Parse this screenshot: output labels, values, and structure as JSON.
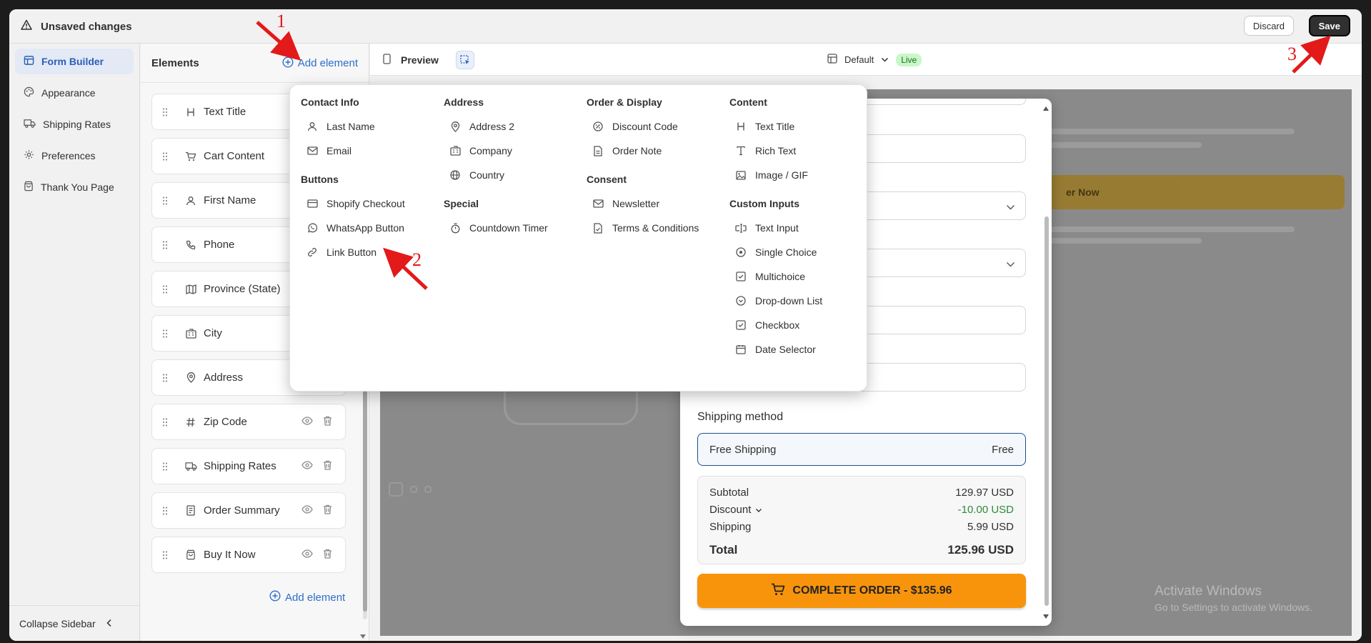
{
  "topbar": {
    "title": "Unsaved changes",
    "discard_label": "Discard",
    "save_label": "Save"
  },
  "sidebar": {
    "items": [
      {
        "label": "Form Builder",
        "icon": "layout-icon",
        "active": true
      },
      {
        "label": "Appearance",
        "icon": "palette-icon",
        "active": false
      },
      {
        "label": "Shipping Rates",
        "icon": "truck-icon",
        "active": false
      },
      {
        "label": "Preferences",
        "icon": "gear-icon",
        "active": false
      },
      {
        "label": "Thank You Page",
        "icon": "bag-icon",
        "active": false
      }
    ],
    "collapse_label": "Collapse Sidebar"
  },
  "elements_panel": {
    "title": "Elements",
    "add_label": "Add element",
    "bottom_add_label": "Add element",
    "items": [
      {
        "label": "Text Title",
        "icon": "heading-icon"
      },
      {
        "label": "Cart Content",
        "icon": "cart-icon"
      },
      {
        "label": "First Name",
        "icon": "user-icon"
      },
      {
        "label": "Phone",
        "icon": "phone-icon"
      },
      {
        "label": "Province (State)",
        "icon": "map-icon"
      },
      {
        "label": "City",
        "icon": "building-icon"
      },
      {
        "label": "Address",
        "icon": "pin-icon"
      },
      {
        "label": "Zip Code",
        "icon": "hash-icon"
      },
      {
        "label": "Shipping Rates",
        "icon": "truck-icon"
      },
      {
        "label": "Order Summary",
        "icon": "receipt-icon"
      },
      {
        "label": "Buy It Now",
        "icon": "bag-icon"
      }
    ]
  },
  "preview": {
    "label": "Preview",
    "template": "Default",
    "status": "Live",
    "ghost_button": "er Now",
    "shipping_method_label": "Shipping method",
    "shipping_option": {
      "name": "Free Shipping",
      "price": "Free"
    },
    "summary": {
      "subtotal_label": "Subtotal",
      "subtotal": "129.97 USD",
      "discount_label": "Discount",
      "discount": "-10.00 USD",
      "shipping_label": "Shipping",
      "shipping": "5.99 USD",
      "total_label": "Total",
      "total": "125.96 USD"
    },
    "cta_label": "COMPLETE ORDER - $135.96",
    "watermark_title": "Activate Windows",
    "watermark_sub": "Go to Settings to activate Windows."
  },
  "dropdown": {
    "columns": [
      {
        "groups": [
          {
            "title": "Contact Info",
            "items": [
              {
                "label": "Last Name",
                "icon": "user-icon"
              },
              {
                "label": "Email",
                "icon": "mail-icon"
              }
            ]
          },
          {
            "title": "Buttons",
            "items": [
              {
                "label": "Shopify Checkout",
                "icon": "card-icon"
              },
              {
                "label": "WhatsApp Button",
                "icon": "whatsapp-icon"
              },
              {
                "label": "Link Button",
                "icon": "link-icon"
              }
            ]
          }
        ]
      },
      {
        "groups": [
          {
            "title": "Address",
            "items": [
              {
                "label": "Address 2",
                "icon": "pin-icon"
              },
              {
                "label": "Company",
                "icon": "building-icon"
              },
              {
                "label": "Country",
                "icon": "globe-icon"
              }
            ]
          },
          {
            "title": "Special",
            "items": [
              {
                "label": "Countdown Timer",
                "icon": "timer-icon"
              }
            ]
          }
        ]
      },
      {
        "groups": [
          {
            "title": "Order & Display",
            "items": [
              {
                "label": "Discount Code",
                "icon": "discount-icon"
              },
              {
                "label": "Order Note",
                "icon": "note-icon"
              }
            ]
          },
          {
            "title": "Consent",
            "items": [
              {
                "label": "Newsletter",
                "icon": "mail-icon"
              },
              {
                "label": "Terms & Conditions",
                "icon": "document-icon"
              }
            ]
          }
        ]
      },
      {
        "groups": [
          {
            "title": "Content",
            "items": [
              {
                "label": "Text Title",
                "icon": "heading-icon"
              },
              {
                "label": "Rich Text",
                "icon": "type-icon"
              },
              {
                "label": "Image / GIF",
                "icon": "image-icon"
              }
            ]
          },
          {
            "title": "Custom Inputs",
            "items": [
              {
                "label": "Text Input",
                "icon": "text-input-icon"
              },
              {
                "label": "Single Choice",
                "icon": "radio-icon"
              },
              {
                "label": "Multichoice",
                "icon": "checkbox-icon"
              },
              {
                "label": "Drop-down List",
                "icon": "chevron-circle-icon"
              },
              {
                "label": "Checkbox",
                "icon": "checkbox-icon"
              },
              {
                "label": "Date Selector",
                "icon": "calendar-icon"
              }
            ]
          }
        ]
      }
    ]
  },
  "annotations": [
    "1",
    "2",
    "3"
  ],
  "colors": {
    "accent": "#2c6ecb",
    "annotation": "#e21a1a",
    "cta": "#f7940c",
    "discount": "#2e8b3a"
  }
}
